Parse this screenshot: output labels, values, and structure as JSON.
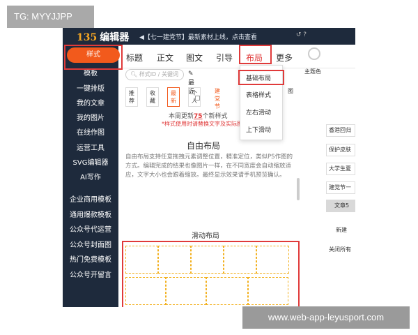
{
  "watermark_top": "TG: MYYJJPP",
  "watermark_bottom": "www.web-app-leyusport.com",
  "topbar": {
    "logo_mark": "135",
    "logo_text": "编辑器",
    "notice": "◀【七一建党节】最新素材上线，点击查看",
    "icons": "↺  ?"
  },
  "sidebar": {
    "active": "样式",
    "items": [
      "模板",
      "一键排版",
      "我的文章",
      "我的图片",
      "在线作图",
      "运营工具",
      "SVG编辑器",
      "AI写作"
    ],
    "items2": [
      "企业商用模板",
      "通用爆款模板",
      "公众号代运营",
      "公众号封面图",
      "热门免费模板",
      "公众号开留言"
    ]
  },
  "tabs": [
    "标题",
    "正文",
    "图文",
    "引导",
    "布局",
    "更多"
  ],
  "theme_label": "主题色",
  "search_placeholder": "样式ID / 关键词",
  "recent": "最近",
  "filters": [
    "推荐",
    "收藏",
    "最新",
    "个人",
    "建党节",
    "图"
  ],
  "dropdown": [
    "基础布局",
    "表格样式",
    "左右滑动",
    "上下滑动"
  ],
  "content": {
    "update_prefix": "本周更新",
    "update_count": "75",
    "update_suffix": "个新样式",
    "notice": "*样式使用时请替换文字及实际图",
    "free_title": "自由布局",
    "free_desc": "自由布局支持任意拖拽元素调整位置，精准定位，类似PS作图的方式。编辑完成的结果也像图片一样，在不同宽度会自动缩放适应，文字大小也会跟着缩放。最终显示效果请手机预览确认。",
    "slide_title": "滑动布局"
  },
  "right_panel": [
    "香港回归",
    "保护皮肤",
    "大学生夏",
    "建党节一",
    "文章5",
    "新建",
    "关闭所有"
  ],
  "colors": {
    "accent": "#f25a1c",
    "sidebar": "#1e2a3c",
    "highlight_red": "#e03a3a",
    "dashed": "#f2b01e"
  }
}
